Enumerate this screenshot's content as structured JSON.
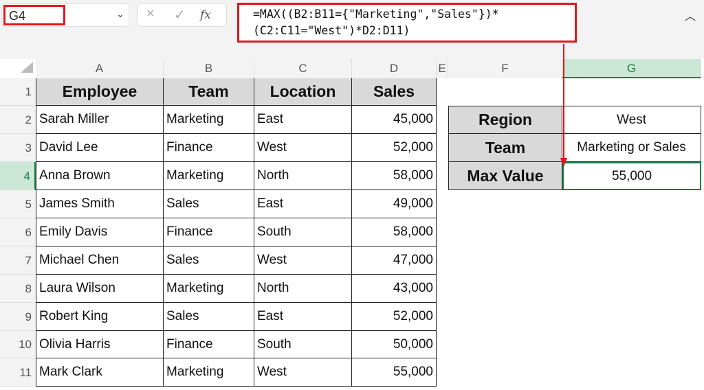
{
  "name_box": "G4",
  "formula_bar": {
    "cancel_icon": "×",
    "enter_icon": "✓",
    "fx_label": "fx",
    "formula_line1": "=MAX((B2:B11={\"Marketing\",\"Sales\"})*",
    "formula_line2": "(C2:C11=\"West\")*D2:D11)"
  },
  "columns": [
    "A",
    "B",
    "C",
    "D",
    "E",
    "F",
    "G"
  ],
  "rows": [
    "1",
    "2",
    "3",
    "4",
    "5",
    "6",
    "7",
    "8",
    "9",
    "10",
    "11"
  ],
  "table": {
    "headers": [
      "Employee",
      "Team",
      "Location",
      "Sales"
    ],
    "data": [
      [
        "Sarah Miller",
        "Marketing",
        "East",
        "45,000"
      ],
      [
        "David Lee",
        "Finance",
        "West",
        "52,000"
      ],
      [
        "Anna Brown",
        "Marketing",
        "North",
        "58,000"
      ],
      [
        "James Smith",
        "Sales",
        "East",
        "49,000"
      ],
      [
        "Emily Davis",
        "Finance",
        "South",
        "58,000"
      ],
      [
        "Michael Chen",
        "Sales",
        "West",
        "47,000"
      ],
      [
        "Laura Wilson",
        "Marketing",
        "North",
        "43,000"
      ],
      [
        "Robert King",
        "Sales",
        "East",
        "52,000"
      ],
      [
        "Olivia Harris",
        "Finance",
        "South",
        "50,000"
      ],
      [
        "Mark Clark",
        "Marketing",
        "West",
        "55,000"
      ]
    ]
  },
  "summary": [
    {
      "label": "Region",
      "value": "West"
    },
    {
      "label": "Team",
      "value": "Marketing or Sales"
    },
    {
      "label": "Max Value",
      "value": "55,000"
    }
  ],
  "colors": {
    "highlight": "#e0161b",
    "selected": "#1e7b45",
    "header_fill": "#d9d9d9"
  }
}
